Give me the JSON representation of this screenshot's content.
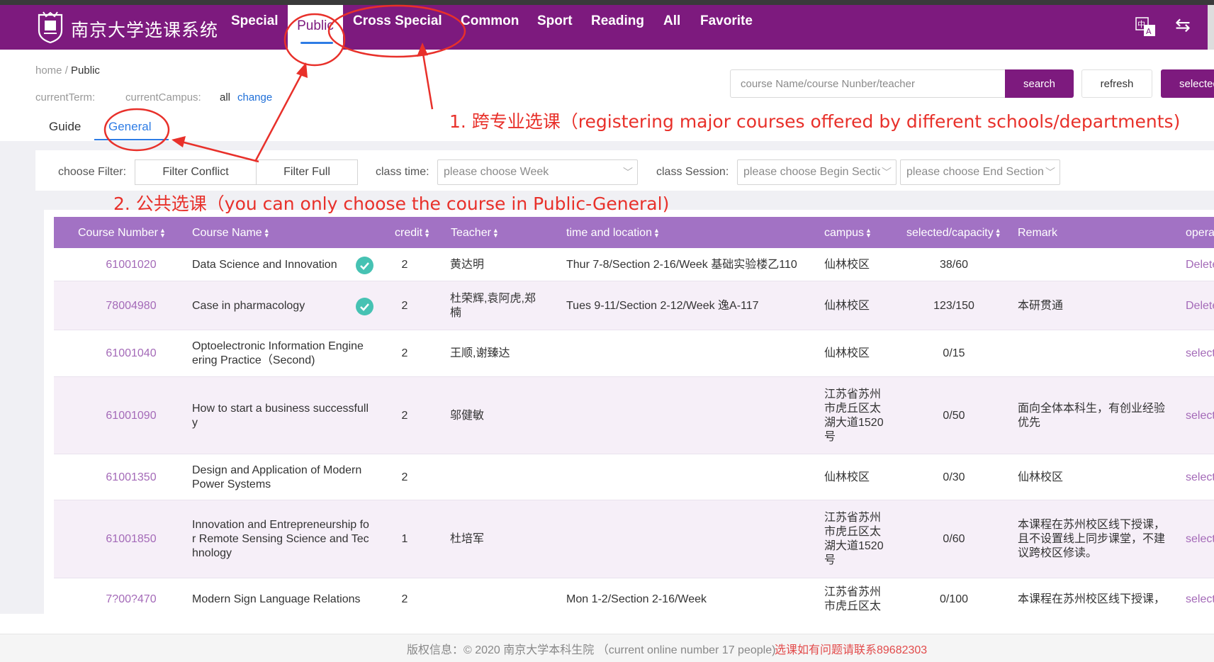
{
  "nav": {
    "brand": "南京大学选课系统",
    "items": [
      "Special",
      "Public",
      "Cross Special",
      "Common",
      "Sport",
      "Reading",
      "All",
      "Favorite"
    ],
    "active": "Public",
    "lang_icon": "中A",
    "switch_icon": "⇆"
  },
  "breadcrumb": {
    "home": "home",
    "sep": "/",
    "current": "Public"
  },
  "meta": {
    "term_label": "currentTerm:",
    "campus_label": "currentCampus:",
    "campus_value": "all",
    "change_link": "change"
  },
  "search": {
    "placeholder": "course Name/course Nunber/teacher",
    "search_label": "search",
    "refresh_label": "refresh",
    "selected_label": "selected"
  },
  "subtabs": {
    "guide": "Guide",
    "general": "General"
  },
  "filters": {
    "choose_filter_label": "choose Filter:",
    "filter_conflict": "Filter Conflict",
    "filter_full": "Filter Full",
    "class_time_label": "class time:",
    "week_placeholder": "please choose Week",
    "class_session_label": "class Session:",
    "begin_placeholder": "please choose Begin Section",
    "end_placeholder": "please choose End Section"
  },
  "table": {
    "headers": {
      "number": "Course Number",
      "name": "Course Name",
      "credit": "credit",
      "teacher": "Teacher",
      "time": "time and location",
      "campus": "campus",
      "capacity": "selected/capacity",
      "remark": "Remark",
      "operate": "operate"
    },
    "rows": [
      {
        "number": "61001020",
        "name": "Data Science and Innovation",
        "credit": "2",
        "teacher": "黄达明",
        "time": "Thur 7-8/Section 2-16/Week 基础实验楼乙110",
        "campus": "仙林校区",
        "capacity": "38/60",
        "remark": "",
        "op": "Delete",
        "selected": true
      },
      {
        "number": "78004980",
        "name": "Case in pharmacology",
        "credit": "2",
        "teacher": "杜荣辉,袁阿虎,郑楠",
        "time": "Tues 9-11/Section 2-12/Week 逸A-117",
        "campus": "仙林校区",
        "capacity": "123/150",
        "remark": "本研贯通",
        "op": "Delete",
        "selected": true
      },
      {
        "number": "61001040",
        "name": "Optoelectronic Information Engineering Practice（Second)",
        "credit": "2",
        "teacher": "王顺,谢臻达",
        "time": "",
        "campus": "仙林校区",
        "capacity": "0/15",
        "remark": "",
        "op": "select",
        "selected": false
      },
      {
        "number": "61001090",
        "name": "How to start a business successfully",
        "credit": "2",
        "teacher": "邬健敏",
        "time": "",
        "campus": "江苏省苏州市虎丘区太湖大道1520号",
        "capacity": "0/50",
        "remark": "面向全体本科生，有创业经验优先",
        "op": "select",
        "selected": false
      },
      {
        "number": "61001350",
        "name": "Design and Application of Modern Power Systems",
        "credit": "2",
        "teacher": "",
        "time": "",
        "campus": "仙林校区",
        "capacity": "0/30",
        "remark": "仙林校区",
        "op": "select",
        "selected": false
      },
      {
        "number": "61001850",
        "name": "Innovation and Entrepreneurship for Remote Sensing Science and Technology",
        "credit": "1",
        "teacher": "杜培军",
        "time": "",
        "campus": "江苏省苏州市虎丘区太湖大道1520号",
        "capacity": "0/60",
        "remark": "本课程在苏州校区线下授课，且不设置线上同步课堂，不建议跨校区修读。",
        "op": "select",
        "selected": false
      },
      {
        "number": "7?00?470",
        "name": "Modern Sign Language Relations",
        "credit": "2",
        "teacher": "",
        "time": "Mon 1-2/Section 2-16/Week",
        "campus": "江苏省苏州市虎丘区太",
        "capacity": "0/100",
        "remark": "本课程在苏州校区线下授课，",
        "op": "select",
        "selected": false
      }
    ]
  },
  "footer": {
    "copyright": "版权信息：© 2020 南京大学本科生院 （current online number 17 people)",
    "contact": "选课如有问题请联系89682303"
  },
  "annotations": {
    "note1": "1. 跨专业选课（registering major courses offered by different schools/departments)",
    "note2": "2. 公共选课（you can only choose the course in Public-General)",
    "color": "#e8302a"
  },
  "colors": {
    "brand": "#7d1a7e",
    "header": "#a272c4",
    "link": "#1f6fd8",
    "number": "#a46ab8"
  }
}
